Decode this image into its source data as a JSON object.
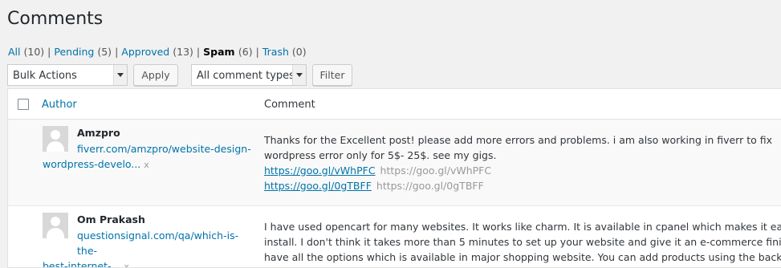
{
  "page": {
    "title": "Comments"
  },
  "filters": {
    "items": [
      {
        "label": "All",
        "count": "(10)"
      },
      {
        "label": "Pending",
        "count": "(5)"
      },
      {
        "label": "Approved",
        "count": "(13)"
      },
      {
        "label": "Spam",
        "count": "(6)"
      },
      {
        "label": "Trash",
        "count": "(0)"
      }
    ],
    "separator": "|"
  },
  "toolbar": {
    "bulk_actions": "Bulk Actions",
    "apply": "Apply",
    "comment_types": "All comment types",
    "filter": "Filter"
  },
  "table": {
    "headers": {
      "author": "Author",
      "comment": "Comment"
    },
    "rows": [
      {
        "author": "Amzpro",
        "url_line1": "fiverr.com/amzpro/website-design-",
        "url_line2": "wordpress-develo...",
        "x": "x",
        "text1": "Thanks for the Excellent post! please add more errors and problems. i am also working in fiverr to fix",
        "text2": "wordpress error only for 5$- 25$. see my gigs.",
        "link1": "https://goo.gl/vWhPFC",
        "link1_plain": "https://goo.gl/vWhPFC",
        "link2": "https://goo.gl/0gTBFF",
        "link2_plain": "https://goo.gl/0gTBFF"
      },
      {
        "author": "Om Prakash",
        "url_line1": "questionsignal.com/qa/which-is-the-",
        "url_line2": "best-internet-...",
        "x": "x",
        "text1": "I have used opencart for many websites. It works like charm. It is available in cpanel which makes it easy to",
        "text2": "install. I don't think it takes more than 5 minutes to set up your website and give it an e-commerce finish. You",
        "text3": "have all the options which is available in major shopping website. You can add products using the backend. No"
      }
    ]
  }
}
